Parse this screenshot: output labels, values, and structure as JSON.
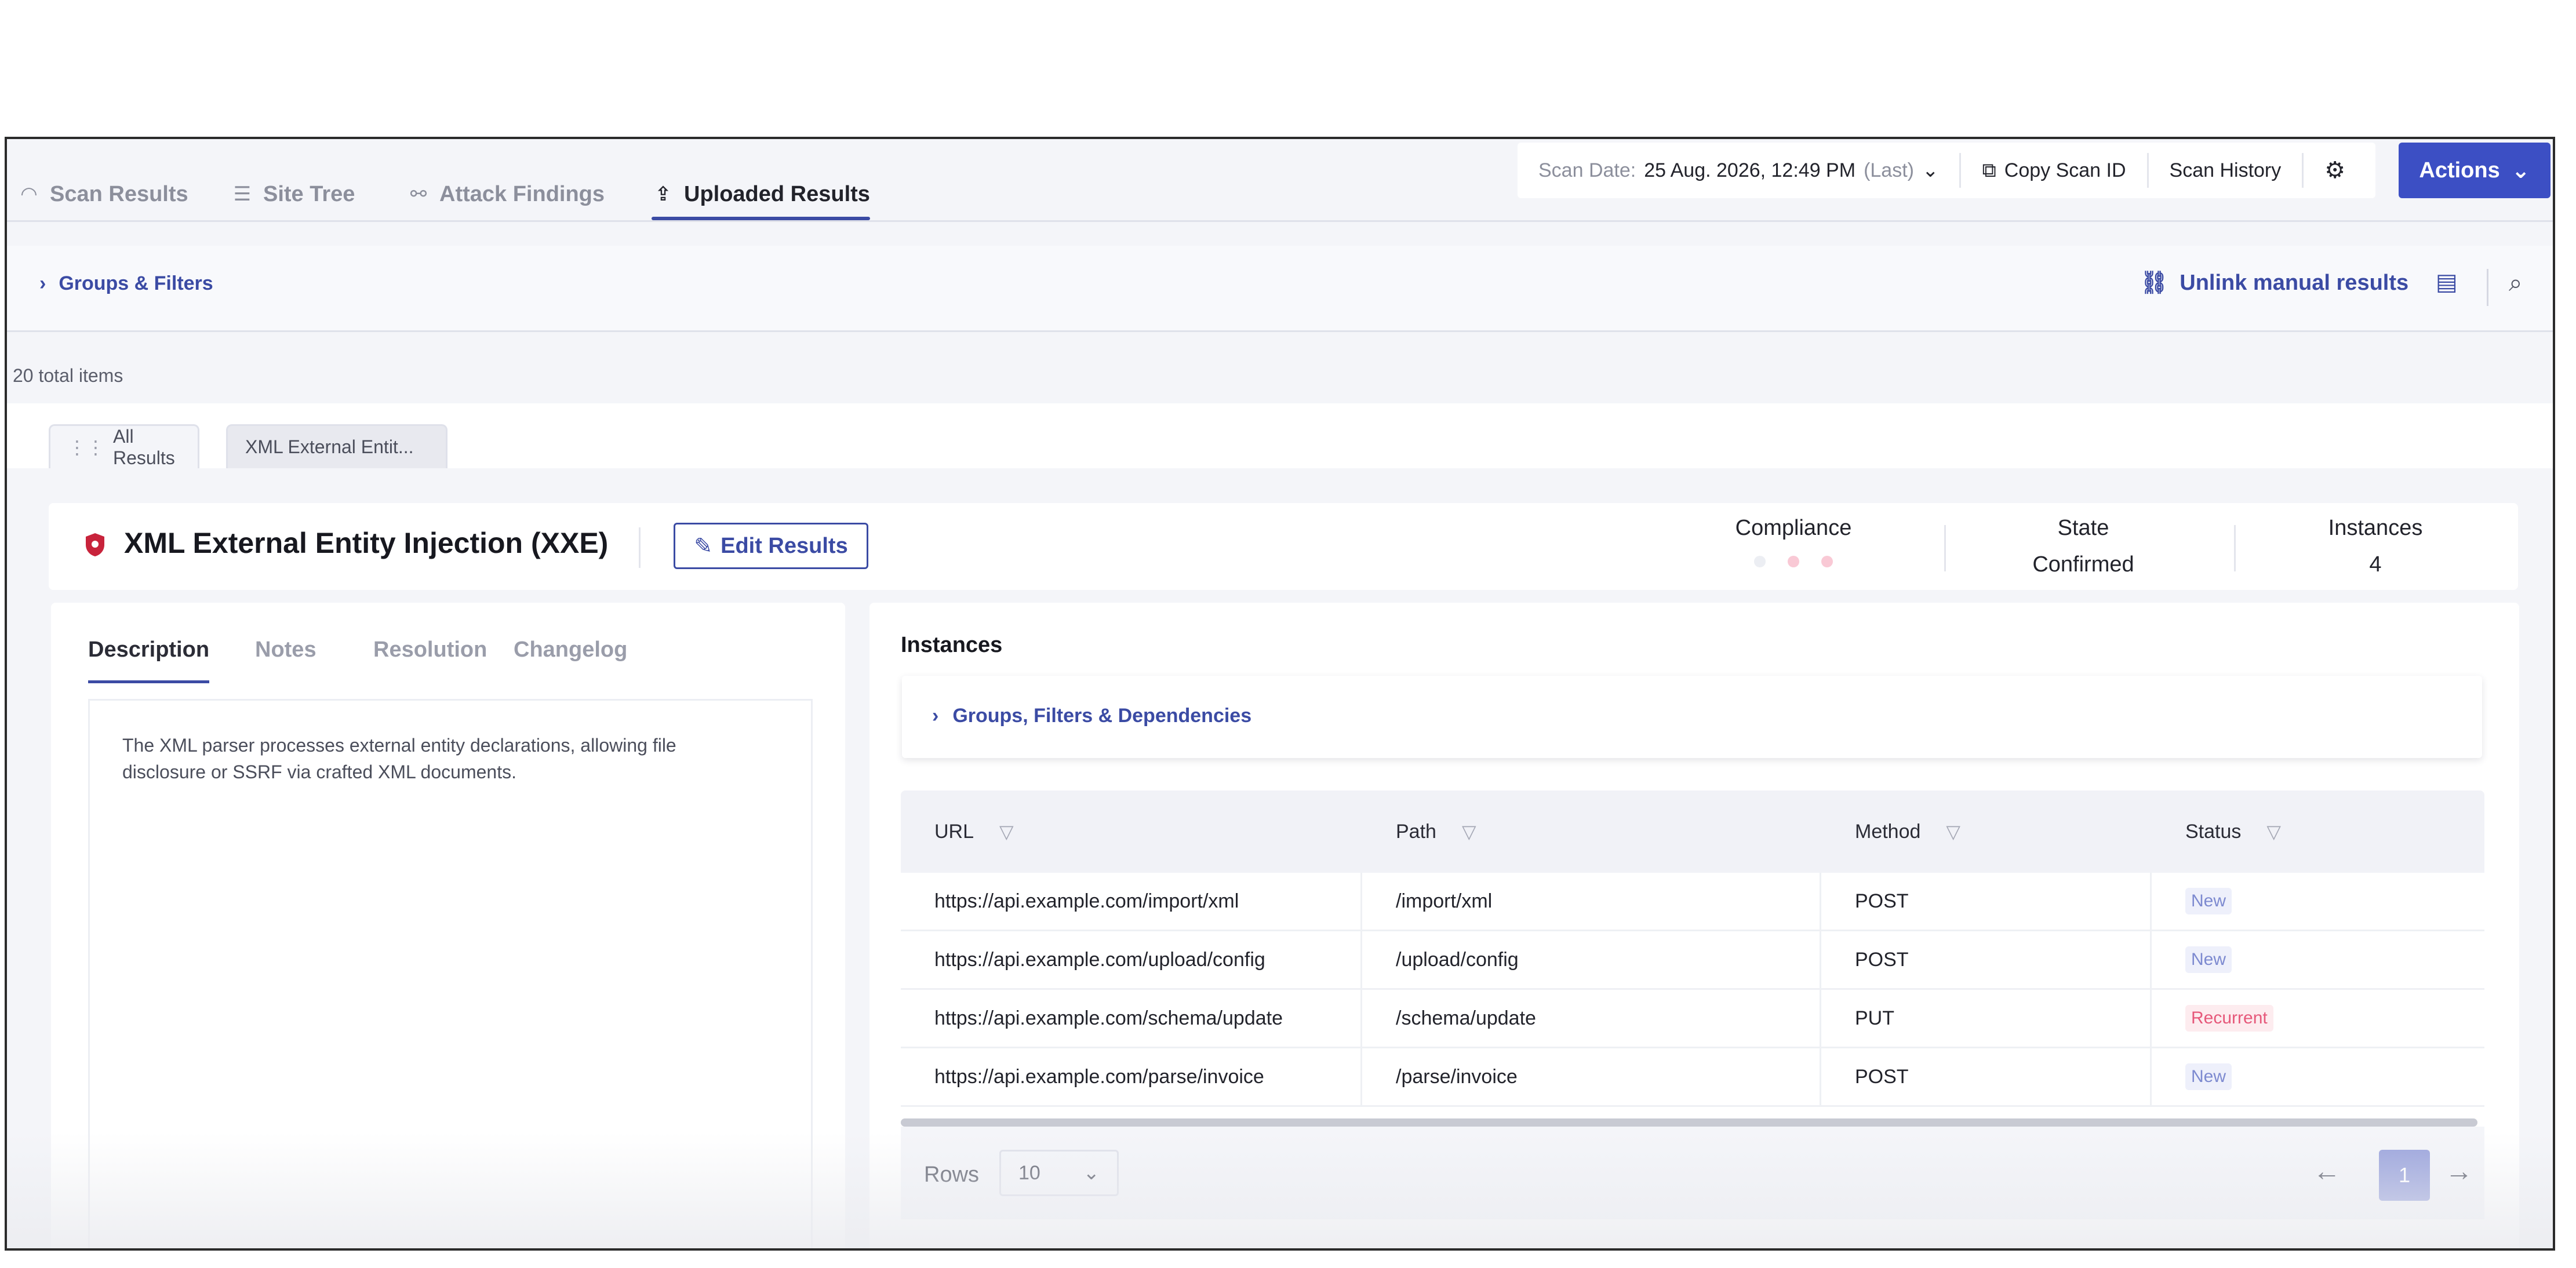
{
  "tabs": [
    {
      "label": "Scan Results",
      "icon": "radar-icon"
    },
    {
      "label": "Site Tree",
      "icon": "tree-icon"
    },
    {
      "label": "Attack Findings",
      "icon": "attack-icon"
    },
    {
      "label": "Uploaded Results",
      "icon": "upload-icon",
      "active": true
    }
  ],
  "scan": {
    "date_label": "Scan Date:",
    "date_value": "25 Aug. 2026, 12:49 PM",
    "date_suffix": "(Last)",
    "copy_id": "Copy Scan ID",
    "history": "Scan History"
  },
  "actions_label": "Actions",
  "filter_bar": {
    "groups_filters": "Groups & Filters",
    "unlink": "Unlink manual results"
  },
  "total_items": "20 total items",
  "subtabs": [
    "All Results",
    "XML External Entit..."
  ],
  "issue": {
    "title": "XML External Entity Injection (XXE)",
    "edit_label": "Edit Results",
    "compliance_label": "Compliance",
    "state_label": "State",
    "state_value": "Confirmed",
    "instances_label": "Instances",
    "instances_value": "4",
    "colors": {
      "accent": "#3b4ba4",
      "severity": "#c8233b"
    }
  },
  "detail_tabs": [
    "Description",
    "Notes",
    "Resolution",
    "Changelog"
  ],
  "description": "The XML parser processes external entity declarations, allowing file disclosure or SSRF via crafted XML documents.",
  "instances": {
    "title": "Instances",
    "groups_label": "Groups, Filters & Dependencies",
    "columns": [
      "URL",
      "Path",
      "Method",
      "Status"
    ],
    "rows": [
      {
        "url": "https://api.example.com/import/xml",
        "path": "/import/xml",
        "method": "POST",
        "status": "New"
      },
      {
        "url": "https://api.example.com/upload/config",
        "path": "/upload/config",
        "method": "POST",
        "status": "New"
      },
      {
        "url": "https://api.example.com/schema/update",
        "path": "/schema/update",
        "method": "PUT",
        "status": "Recurrent"
      },
      {
        "url": "https://api.example.com/parse/invoice",
        "path": "/parse/invoice",
        "method": "POST",
        "status": "New"
      }
    ],
    "rows_label": "Rows",
    "rows_value": "10",
    "current_page": "1"
  }
}
